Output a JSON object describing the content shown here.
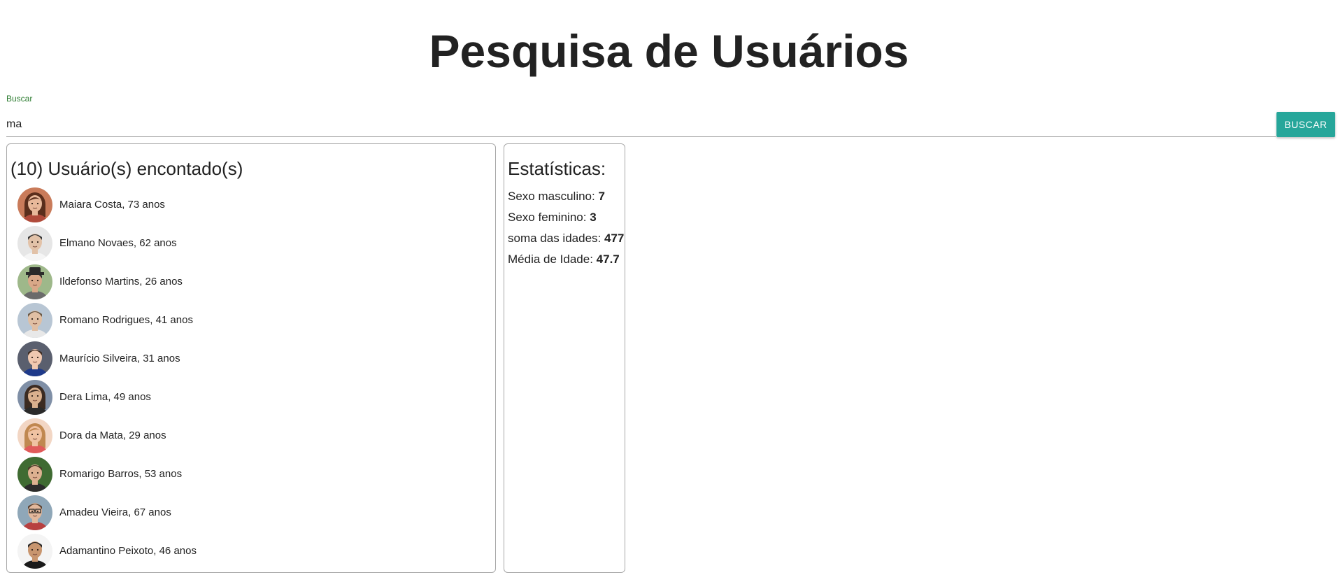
{
  "header": {
    "title": "Pesquisa de Usuários"
  },
  "search": {
    "label": "Buscar",
    "value": "ma",
    "button_label": "BUSCAR"
  },
  "results": {
    "heading": "(10) Usuário(s) encontado(s)",
    "users": [
      {
        "name": "Maiara Costa, 73 anos",
        "avatar": "female-portrait-avatar",
        "bg": "#c97b5a",
        "skin": "#e8b89a",
        "hair": "#5a2e1c",
        "shirt": "#b04a3a"
      },
      {
        "name": "Elmano Novaes, 62 anos",
        "avatar": "male-portrait-avatar",
        "bg": "#e6e6e6",
        "skin": "#e2c2a8",
        "hair": "#3a3a3a",
        "shirt": "#f5f5f5"
      },
      {
        "name": "Ildefonso Martins, 26 anos",
        "avatar": "male-hat-portrait-avatar",
        "bg": "#9eb88a",
        "skin": "#d8a888",
        "hair": "#2f2f2f",
        "shirt": "#6b6b6b"
      },
      {
        "name": "Romano Rodrigues, 41 anos",
        "avatar": "male-portrait-avatar",
        "bg": "#b8c6d4",
        "skin": "#e0bfa4",
        "hair": "#6b5a48",
        "shirt": "#e8e8e8"
      },
      {
        "name": "Maurício Silveira, 31 anos",
        "avatar": "male-portrait-avatar",
        "bg": "#5a5f6e",
        "skin": "#f0c8b0",
        "hair": "#3b2a20",
        "shirt": "#1e3a8a"
      },
      {
        "name": "Dera Lima, 49 anos",
        "avatar": "female-portrait-avatar",
        "bg": "#7f8fa6",
        "skin": "#d9b08e",
        "hair": "#3b2b22",
        "shirt": "#2a2a2a"
      },
      {
        "name": "Dora da Mata, 29 anos",
        "avatar": "female-portrait-avatar",
        "bg": "#f2d6c4",
        "skin": "#f0c2a2",
        "hair": "#c08850",
        "shirt": "#e05a5a"
      },
      {
        "name": "Romarigo Barros, 53 anos",
        "avatar": "male-portrait-avatar",
        "bg": "#3f6b32",
        "skin": "#dcb090",
        "hair": "#4a3a2a",
        "shirt": "#2b2b2b"
      },
      {
        "name": "Amadeu Vieira, 67 anos",
        "avatar": "male-glasses-portrait-avatar",
        "bg": "#8fa7b8",
        "skin": "#e2b89c",
        "hair": "#5a4232",
        "shirt": "#b84040"
      },
      {
        "name": "Adamantino Peixoto, 46 anos",
        "avatar": "male-portrait-avatar",
        "bg": "#f4f4f4",
        "skin": "#c8956e",
        "hair": "#2a2a2a",
        "shirt": "#1a1a1a"
      }
    ]
  },
  "stats": {
    "heading": "Estatísticas:",
    "items": [
      {
        "label": "Sexo masculino: ",
        "value": "7"
      },
      {
        "label": "Sexo feminino: ",
        "value": "3"
      },
      {
        "label": "soma das idades: ",
        "value": "477"
      },
      {
        "label": "Média de Idade: ",
        "value": "47.7"
      }
    ]
  },
  "colors": {
    "accent": "#26a69a",
    "label": "#2e7d32",
    "border": "#a8a8a8",
    "text": "#222222"
  }
}
